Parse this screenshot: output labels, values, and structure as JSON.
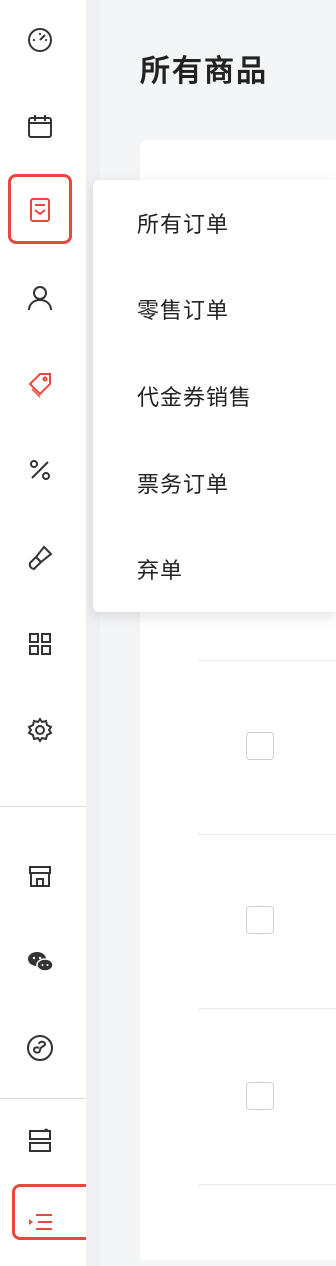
{
  "page": {
    "title": "所有商品"
  },
  "dropdown": {
    "items": [
      "所有订单",
      "零售订单",
      "代金券销售",
      "票务订单",
      "弃单"
    ]
  },
  "sidebar": {
    "icons": [
      "dashboard-icon",
      "calendar-icon",
      "orders-icon",
      "user-icon",
      "tag-icon",
      "percent-icon",
      "brush-icon",
      "apps-grid-icon",
      "settings-icon",
      "store-icon",
      "wechat-icon",
      "mini-program-icon",
      "layout-icon",
      "collapse-menu-icon"
    ],
    "active_color": "#e8483c"
  },
  "colors": {
    "accent": "#e8483c",
    "icon": "#333333"
  }
}
